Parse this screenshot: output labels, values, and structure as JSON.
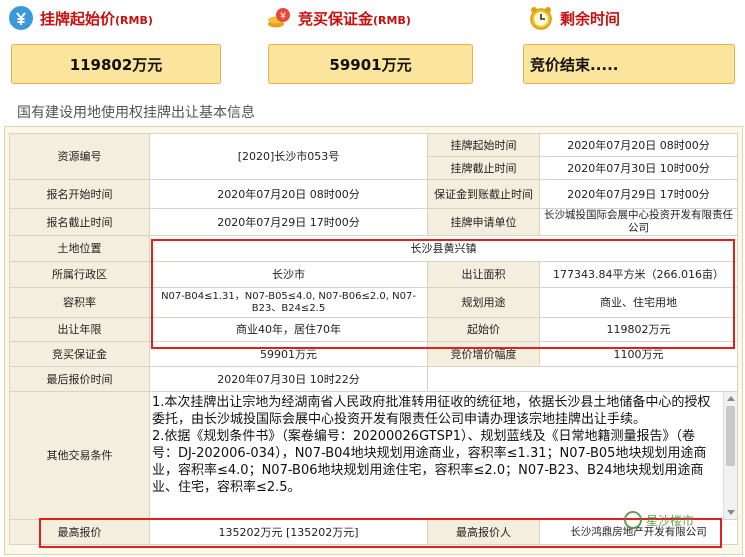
{
  "header": {
    "start_price": {
      "label": "挂牌起始价",
      "unit": "(RMB)",
      "value": "119802万元",
      "icon": "money-bag-icon"
    },
    "deposit": {
      "label": "竞买保证金",
      "unit": "(RMB)",
      "value": "59901万元",
      "icon": "coin-stack-icon"
    },
    "remaining": {
      "label": "剩余时间",
      "value": "竞价结束.....",
      "icon": "alarm-clock-icon"
    }
  },
  "section_title": "国有建设用地使用权挂牌出让基本信息",
  "table": {
    "r1": {
      "k1": "资源编号",
      "v1": "[2020]长沙市053号",
      "k2": "挂牌起始时间",
      "v2": "2020年07月20日 08时00分"
    },
    "r2": {
      "k2": "挂牌截止时间",
      "v2": "2020年07月30日 10时00分"
    },
    "r3": {
      "k1": "报名开始时间",
      "v1": "2020年07月20日 08时00分",
      "k2": "保证金到账截止时间",
      "v2": "2020年07月29日 17时00分"
    },
    "r4": {
      "k1": "报名截止时间",
      "v1": "2020年07月29日 17时00分",
      "k2": "挂牌申请单位",
      "v2": "长沙城投国际会展中心投资开发有限责任公司"
    },
    "r5": {
      "k1": "土地位置",
      "v1": "长沙县黄兴镇"
    },
    "r6": {
      "k1": "所属行政区",
      "v1": "长沙市",
      "k2": "出让面积",
      "v2": "177343.84平方米（266.016亩）"
    },
    "r7": {
      "k1": "容积率",
      "v1": "N07-B04≤1.31，N07-B05≤4.0, N07-B06≤2.0, N07-B23、B24≤2.5",
      "k2": "规划用途",
      "v2": "商业、住宅用地"
    },
    "r8": {
      "k1": "出让年限",
      "v1": "商业40年，居住70年",
      "k2": "起始价",
      "v2": "119802万元"
    },
    "r9": {
      "k1": "竞买保证金",
      "v1": "59901万元",
      "k2": "竞价增价幅度",
      "v2": "1100万元"
    },
    "r10": {
      "k1": "最后报价时间",
      "v1": "2020年07月30日 10时22分"
    },
    "r11": {
      "k1": "其他交易条件",
      "lines": [
        "1.本次挂牌出让宗地为经湖南省人民政府批准转用征收的统征地，依据长沙县土地储备中心的授权委托，由长沙城投国际会展中心投资开发有限责任公司申请办理该宗地挂牌出让手续。",
        "2.依据《规划条件书》（案卷编号：20200026GTSP1）、规划蓝线及《日常地籍测量报告》（卷号：DJ-202006-034），N07-B04地块规划用途商业，容积率≤1.31；N07-B05地块规划用途商业，容积率≤4.0；N07-B06地块规划用途住宅，容积率≤2.0；N07-B23、B24地块规划用途商业、住宅，容积率≤2.5。"
      ]
    },
    "r12": {
      "k1": "最高报价",
      "v1": "135202万元 [135202万元]",
      "k2": "最高报价人",
      "v2": "长沙鸿鼎房地产开发有限公司"
    }
  },
  "watermark": "星沙楼市"
}
